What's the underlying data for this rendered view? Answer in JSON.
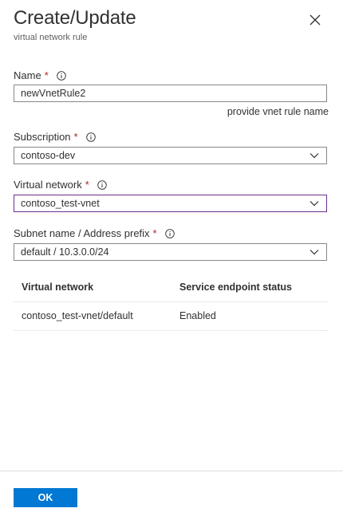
{
  "header": {
    "title": "Create/Update",
    "subtitle": "virtual network rule"
  },
  "form": {
    "name": {
      "label": "Name",
      "required_mark": "*",
      "value": "newVnetRule2",
      "hint": "provide vnet rule name"
    },
    "subscription": {
      "label": "Subscription",
      "required_mark": "*",
      "selected": "contoso-dev"
    },
    "virtual_network": {
      "label": "Virtual network",
      "required_mark": "*",
      "selected": "contoso_test-vnet"
    },
    "subnet": {
      "label": "Subnet name / Address prefix",
      "required_mark": "*",
      "selected": "default / 10.3.0.0/24"
    }
  },
  "table": {
    "headers": [
      "Virtual network",
      "Service endpoint status"
    ],
    "rows": [
      [
        "contoso_test-vnet/default",
        "Enabled"
      ]
    ]
  },
  "footer": {
    "ok_label": "OK"
  },
  "colors": {
    "accent": "#0078d4",
    "required": "#a4262c",
    "focus_border": "#6b2f8b"
  },
  "icons": {
    "close": "close-icon",
    "info": "info-icon",
    "dropdown": "chevron-down-icon"
  }
}
